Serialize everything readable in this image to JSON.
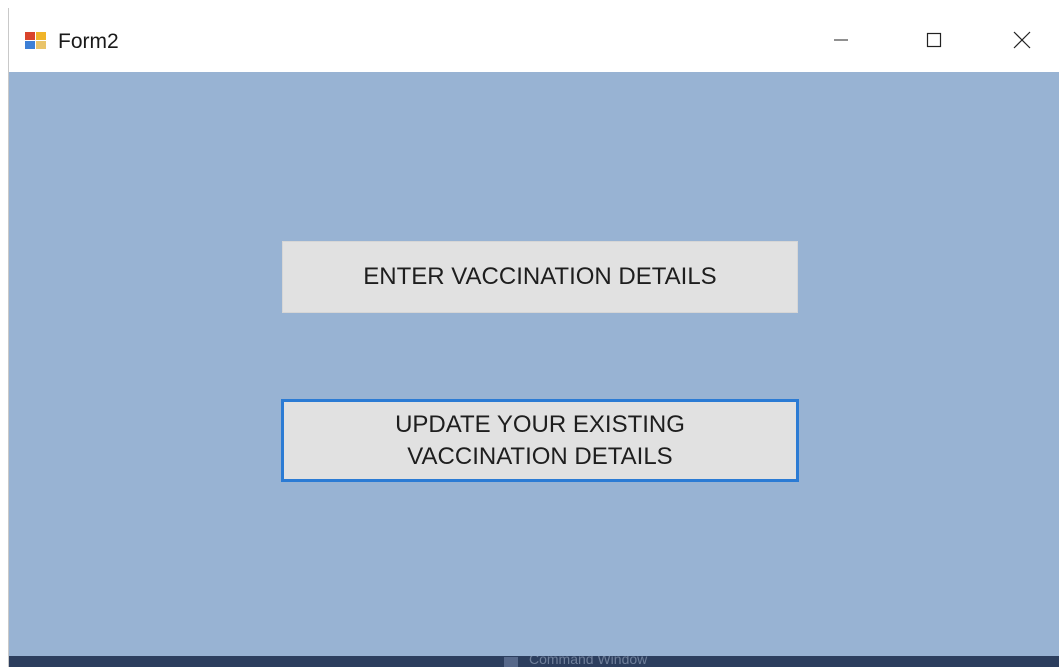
{
  "window": {
    "title": "Form2",
    "icon": "windows-form-icon",
    "controls": {
      "minimize_icon": "minimize-icon",
      "maximize_icon": "maximize-icon",
      "close_icon": "close-icon"
    }
  },
  "form": {
    "background_color": "#98b3d3",
    "buttons": {
      "enter_label": "ENTER VACCINATION DETAILS",
      "update_label_line1": "UPDATE YOUR EXISTING",
      "update_label_line2": "VACCINATION DETAILS",
      "focus_border_color": "#2b7bd4"
    }
  },
  "taskbar": {
    "label": "Command Window"
  }
}
